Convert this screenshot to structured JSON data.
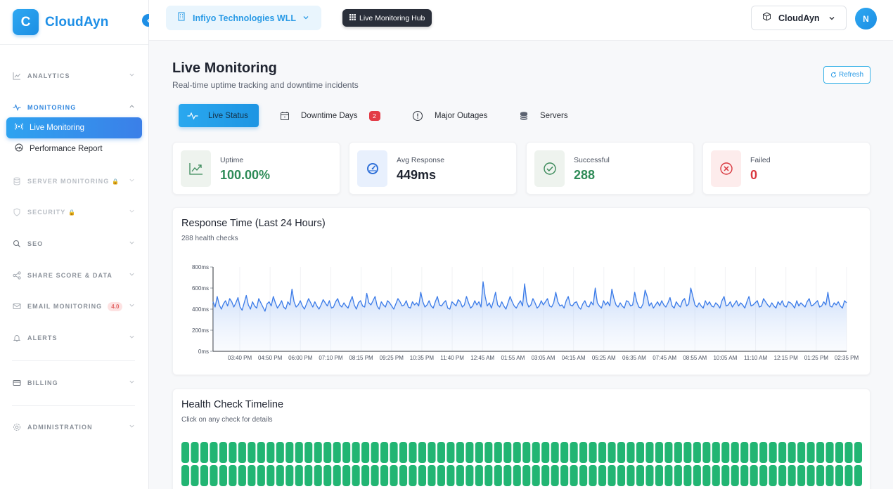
{
  "brand": {
    "logo_letter": "C",
    "name": "CloudAyn"
  },
  "sidebar": {
    "sections": [
      {
        "label": "ANALYTICS",
        "icon": "chart-icon"
      },
      {
        "label": "MONITORING",
        "icon": "pulse-icon",
        "active": true
      },
      {
        "label": "SERVER MONITORING",
        "icon": "database-icon",
        "locked": true
      },
      {
        "label": "SECURITY",
        "icon": "shield-icon",
        "locked": true
      },
      {
        "label": "SEO",
        "icon": "search-icon"
      },
      {
        "label": "SHARE SCORE & DATA",
        "icon": "share-icon"
      },
      {
        "label": "EMAIL MONITORING",
        "icon": "mail-icon",
        "badge": "4.0"
      },
      {
        "label": "ALERTS",
        "icon": "bell-icon"
      },
      {
        "label": "BILLING",
        "icon": "card-icon"
      },
      {
        "label": "ADMINISTRATION",
        "icon": "gear-icon"
      }
    ],
    "items": [
      {
        "label": "Live Monitoring",
        "icon": "broadcast-icon",
        "active": true
      },
      {
        "label": "Performance Report",
        "icon": "gauge-icon"
      }
    ]
  },
  "topbar": {
    "org": "Infiyo Technologies WLL",
    "hub": "Live Monitoring Hub",
    "account": "CloudAyn",
    "avatar": "N"
  },
  "page": {
    "title": "Live Monitoring",
    "subtitle": "Real-time uptime tracking and downtime incidents",
    "refresh": "Refresh"
  },
  "tabs": [
    {
      "label": "Live Status",
      "icon": "pulse-icon",
      "active": true
    },
    {
      "label": "Downtime Days",
      "icon": "calendar-icon",
      "badge": "2"
    },
    {
      "label": "Major Outages",
      "icon": "alert-circle-icon"
    },
    {
      "label": "Servers",
      "icon": "database-icon"
    }
  ],
  "stats": [
    {
      "label": "Uptime",
      "value": "100.00%",
      "color": "#2e8b57",
      "bg": "#eef3ee",
      "icon": "trend-up-icon"
    },
    {
      "label": "Avg Response",
      "value": "449ms",
      "color": "#1f2430",
      "bg": "#e8f0fd",
      "icon": "speedometer-icon"
    },
    {
      "label": "Successful",
      "value": "288",
      "color": "#2e8b57",
      "bg": "#eef3ee",
      "icon": "check-circle-icon"
    },
    {
      "label": "Failed",
      "value": "0",
      "color": "#d9383f",
      "bg": "#fdecec",
      "icon": "x-circle-icon"
    }
  ],
  "response_chart": {
    "title": "Response Time (Last 24 Hours)",
    "subtitle": "288 health checks"
  },
  "chart_data": {
    "type": "area",
    "ylim": [
      0,
      800
    ],
    "yticks": [
      "0ms",
      "200ms",
      "400ms",
      "600ms",
      "800ms"
    ],
    "ytick_values": [
      0,
      200,
      400,
      600,
      800
    ],
    "x_labels": [
      "03:40 PM",
      "04:50 PM",
      "06:00 PM",
      "07:10 PM",
      "08:15 PM",
      "09:25 PM",
      "10:35 PM",
      "11:40 PM",
      "12:45 AM",
      "01:55 AM",
      "03:05 AM",
      "04:15 AM",
      "05:25 AM",
      "06:35 AM",
      "07:45 AM",
      "08:55 AM",
      "10:05 AM",
      "11:10 AM",
      "12:15 PM",
      "01:25 PM",
      "02:35 PM"
    ],
    "series": [
      {
        "color": "#3b7be8",
        "values": [
          470,
          420,
          520,
          440,
          400,
          450,
          480,
          430,
          500,
          470,
          420,
          460,
          510,
          420,
          390,
          460,
          530,
          440,
          400,
          470,
          430,
          410,
          500,
          460,
          420,
          380,
          450,
          470,
          430,
          520,
          460,
          410,
          440,
          480,
          420,
          400,
          470,
          440,
          590,
          470,
          420,
          440,
          480,
          430,
          400,
          450,
          500,
          460,
          420,
          470,
          430,
          400,
          440,
          490,
          460,
          430,
          480,
          410,
          420,
          470,
          500,
          440,
          420,
          460,
          430,
          410,
          470,
          520,
          440,
          400,
          460,
          480,
          430,
          420,
          550,
          460,
          440,
          480,
          520,
          430,
          400,
          470,
          440,
          420,
          480,
          460,
          430,
          400,
          450,
          500,
          470,
          430,
          440,
          480,
          420,
          410,
          470,
          440,
          460,
          430,
          560,
          470,
          420,
          440,
          480,
          430,
          410,
          470,
          520,
          440,
          430,
          460,
          480,
          410,
          400,
          470,
          450,
          430,
          490,
          470,
          420,
          440,
          520,
          460,
          410,
          430,
          480,
          440,
          470,
          420,
          660,
          520,
          430,
          460,
          410,
          480,
          560,
          440,
          420,
          470,
          430,
          400,
          460,
          520,
          470,
          430,
          410,
          450,
          480,
          430,
          640,
          470,
          420,
          440,
          500,
          460,
          410,
          430,
          480,
          440,
          470,
          500,
          430,
          420,
          460,
          560,
          470,
          430,
          440,
          410,
          480,
          520,
          440,
          430,
          460,
          470,
          420,
          400,
          450,
          480,
          430,
          420,
          470,
          440,
          600,
          460,
          430,
          410,
          480,
          440,
          470,
          430,
          590,
          500,
          440,
          420,
          460,
          430,
          410,
          480,
          470,
          430,
          440,
          560,
          470,
          420,
          410,
          450,
          580,
          520,
          430,
          460,
          410,
          440,
          470,
          430,
          480,
          440,
          420,
          460,
          510,
          430,
          410,
          470,
          440,
          420,
          480,
          500,
          430,
          450,
          600,
          520,
          440,
          420,
          460,
          430,
          410,
          480,
          440,
          470,
          430,
          420,
          460,
          440,
          410,
          480,
          520,
          430,
          440,
          470,
          420,
          450,
          480,
          430,
          460,
          440,
          410,
          470,
          520,
          430,
          440,
          460,
          480,
          420,
          430,
          500,
          470,
          440,
          420,
          460,
          430,
          410,
          470,
          440,
          480,
          430,
          420,
          470,
          460,
          440,
          410,
          480,
          430,
          460,
          440,
          420,
          470,
          500,
          430,
          440,
          460,
          480,
          420,
          430,
          470,
          440,
          560,
          430,
          420,
          460,
          440,
          470,
          430,
          410,
          480,
          460
        ]
      }
    ]
  },
  "timeline": {
    "title": "Health Check Timeline",
    "subtitle": "Click on any check for details",
    "success_color": "#22b573",
    "columns": 72,
    "rows": 2
  }
}
